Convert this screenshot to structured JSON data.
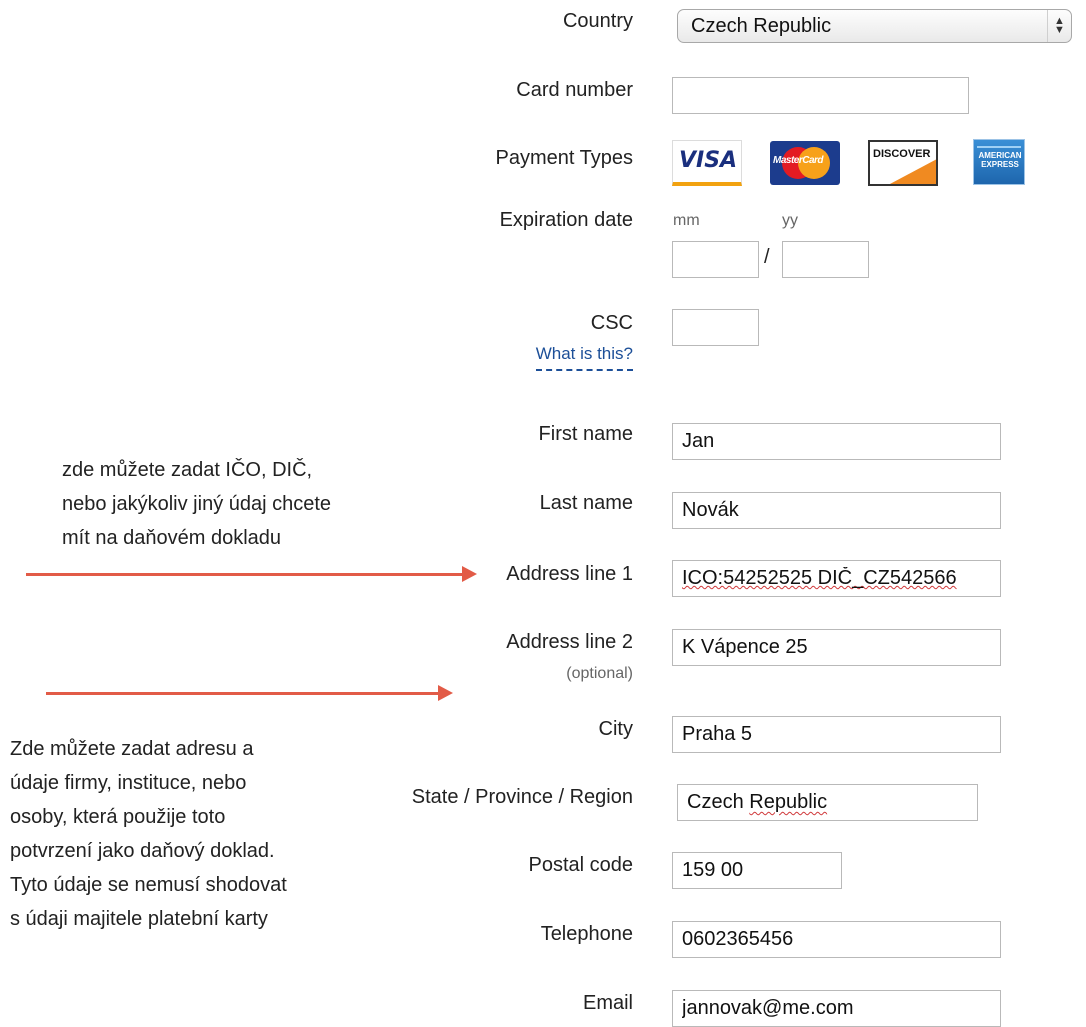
{
  "form": {
    "country": {
      "label": "Country",
      "value": "Czech Republic"
    },
    "card_number": {
      "label": "Card number",
      "value": ""
    },
    "payment_types": {
      "label": "Payment Types",
      "cards": [
        "VISA",
        "MasterCard",
        "DISCOVER",
        "AMERICAN EXPRESS"
      ]
    },
    "expiration": {
      "label": "Expiration date",
      "mm_hint": "mm",
      "yy_hint": "yy",
      "separator": "/",
      "mm_value": "",
      "yy_value": ""
    },
    "csc": {
      "label": "CSC",
      "help_link": "What is this?",
      "value": ""
    },
    "first_name": {
      "label": "First name",
      "value": "Jan"
    },
    "last_name": {
      "label": "Last name",
      "value": "Novák"
    },
    "address1": {
      "label": "Address line 1",
      "value": "ICO:54252525 DIČ_CZ542566"
    },
    "address2": {
      "label": "Address line 2",
      "optional": "(optional)",
      "value": "K Vápence 25"
    },
    "city": {
      "label": "City",
      "value": "Praha 5"
    },
    "state": {
      "label": "State / Province / Region",
      "value_part1": "Czech",
      "value_part2": "Republic"
    },
    "postal": {
      "label": "Postal code",
      "value": "159 00"
    },
    "telephone": {
      "label": "Telephone",
      "value": "0602365456"
    },
    "email": {
      "label": "Email",
      "value": "jannovak@me.com"
    }
  },
  "notes": {
    "top": [
      "zde můžete zadat IČO, DIČ,",
      "nebo jakýkoliv jiný údaj chcete",
      "mít na daňovém dokladu"
    ],
    "bottom": [
      "Zde můžete zadat adresu a",
      "údaje firmy, instituce, nebo",
      "osoby, která  použije toto",
      "potvrzení jako daňový doklad.",
      "Tyto údaje se nemusí shodovat",
      "s údaji majitele platební karty"
    ]
  },
  "colors": {
    "annotation_arrow": "#e25b47",
    "link": "#1c4f98",
    "spellcheck": "#d0383a"
  }
}
